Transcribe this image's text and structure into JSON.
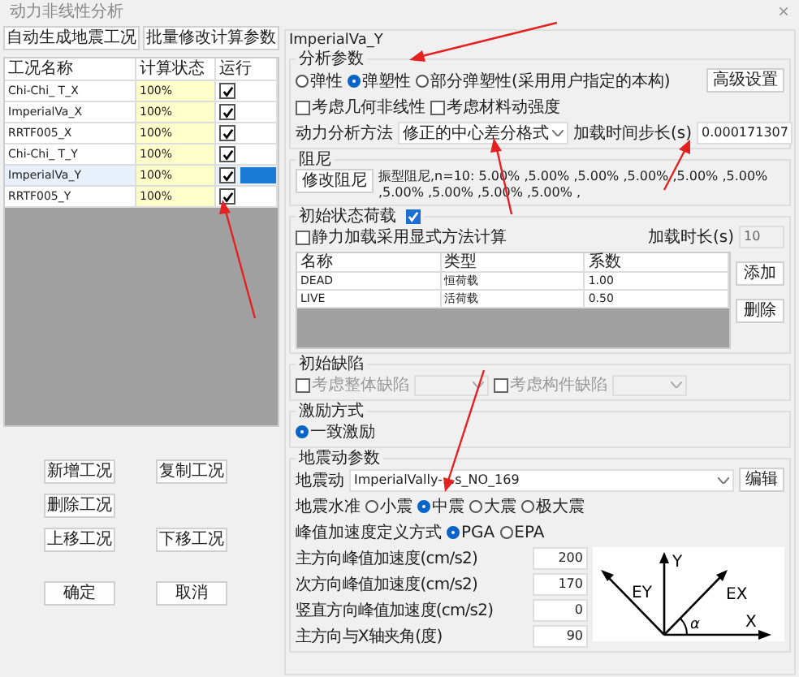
{
  "window": {
    "title": "动力非线性分析",
    "close": "×"
  },
  "left": {
    "top_buttons": [
      "自动生成地震工况",
      "批量修改计算参数"
    ],
    "table": {
      "columns": [
        "工况名称",
        "计算状态",
        "运行"
      ],
      "rows": [
        {
          "name": "Chi-Chi_ T_X",
          "status": "100%",
          "run": true,
          "selected": false
        },
        {
          "name": "ImperialVa_X",
          "status": "100%",
          "run": true,
          "selected": false
        },
        {
          "name": "RRTF005_X",
          "status": "100%",
          "run": true,
          "selected": false
        },
        {
          "name": "Chi-Chi_ T_Y",
          "status": "100%",
          "run": true,
          "selected": false
        },
        {
          "name": "ImperialVa_Y",
          "status": "100%",
          "run": true,
          "selected": true
        },
        {
          "name": "RRTF005_Y",
          "status": "100%",
          "run": true,
          "selected": false
        }
      ]
    },
    "buttons": [
      [
        "新增工况",
        "复制工况"
      ],
      [
        "删除工况"
      ],
      [
        "上移工况",
        "下移工况"
      ],
      [
        "确定",
        "取消"
      ]
    ]
  },
  "panel": {
    "title": "ImperialVa_Y",
    "analysis": {
      "label": "分析参数",
      "options": [
        {
          "label": "弹性",
          "selected": false
        },
        {
          "label": "弹塑性",
          "selected": true
        },
        {
          "label": "部分弹塑性(采用用户指定的本构)",
          "selected": false
        }
      ],
      "advanced_button": "高级设置",
      "checkboxes": [
        {
          "label": "考虑几何非线性",
          "checked": false
        },
        {
          "label": "考虑材料动强度",
          "checked": false
        }
      ],
      "method_label": "动力分析方法",
      "method_value": "修正的中心差分格式",
      "step_label": "加载时间步长(s)",
      "step_value": "0.000171307"
    },
    "damping": {
      "label": "阻尼",
      "button": "修改阻尼",
      "text": "振型阻尼,n=10: 5.00% ,5.00% ,5.00% ,5.00% ,5.00% ,5.00% ,5.00% ,5.00% ,5.00% ,5.00% ,"
    },
    "initial_load": {
      "label": "初始状态荷载",
      "enabled": true,
      "static_checkbox": {
        "label": "静力加载采用显式方法计算",
        "checked": false
      },
      "duration_label": "加载时长(s)",
      "duration_value": "10",
      "table": {
        "columns": [
          "名称",
          "类型",
          "系数"
        ],
        "rows": [
          [
            "DEAD",
            "恒荷载",
            "1.00"
          ],
          [
            "LIVE",
            "活荷载",
            "0.50"
          ]
        ]
      },
      "buttons": [
        "添加",
        "删除"
      ]
    },
    "defects": {
      "label": "初始缺陷",
      "checkboxes": [
        {
          "label": "考虑整体缺陷",
          "checked": false
        },
        {
          "label": "考虑构件缺陷",
          "checked": false
        }
      ]
    },
    "excitation": {
      "label": "激励方式",
      "options": [
        {
          "label": "一致激励",
          "selected": true
        }
      ]
    },
    "ground_motion": {
      "label": "地震动参数",
      "record_label": "地震动",
      "record_value": "ImperialVally-...s_NO_169",
      "edit_button": "编辑",
      "level_label": "地震水准",
      "levels": [
        {
          "label": "小震",
          "selected": false
        },
        {
          "label": "中震",
          "selected": true
        },
        {
          "label": "大震",
          "selected": false
        },
        {
          "label": "极大震",
          "selected": false
        }
      ],
      "peak_label": "峰值加速度定义方式",
      "peak_options": [
        {
          "label": "PGA",
          "selected": true
        },
        {
          "label": "EPA",
          "selected": false
        }
      ],
      "fields": [
        {
          "label": "主方向峰值加速度(cm/s2)",
          "value": "200"
        },
        {
          "label": "次方向峰值加速度(cm/s2)",
          "value": "170"
        },
        {
          "label": "竖直方向峰值加速度(cm/s2)",
          "value": "0"
        },
        {
          "label": "主方向与X轴夹角(度)",
          "value": "90"
        }
      ],
      "diagram": {
        "y": "Y",
        "ey": "EY",
        "ex": "EX",
        "x": "X",
        "alpha": "α"
      }
    }
  }
}
